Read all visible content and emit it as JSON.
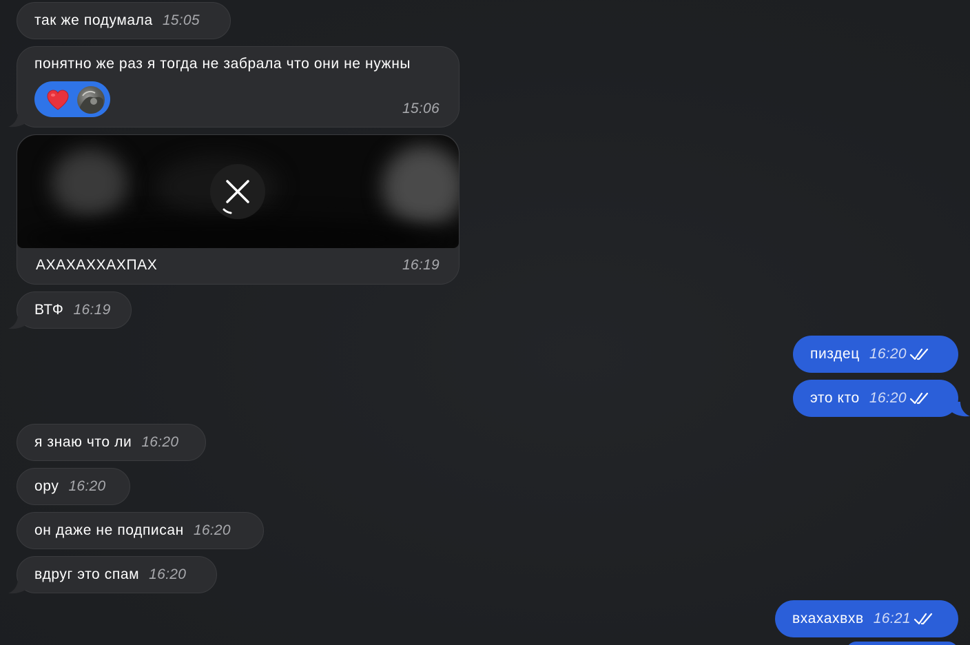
{
  "messages": [
    {
      "id": "m1",
      "text": "так же подумала",
      "time": "15:05"
    },
    {
      "id": "m2",
      "text": "понятно же раз я тогда не забрала что они не нужны",
      "time": "15:06"
    },
    {
      "id": "m3",
      "text": "АХАХАХХАХПАХ",
      "time": "16:19"
    },
    {
      "id": "m4",
      "text": "ВТФ",
      "time": "16:19"
    },
    {
      "id": "m5",
      "text": "пиздец",
      "time": "16:20"
    },
    {
      "id": "m6",
      "text": "это кто",
      "time": "16:20"
    },
    {
      "id": "m7",
      "text": "я знаю что ли",
      "time": "16:20"
    },
    {
      "id": "m8",
      "text": "ору",
      "time": "16:20"
    },
    {
      "id": "m9",
      "text": "он даже не подписан",
      "time": "16:20"
    },
    {
      "id": "m10",
      "text": "вдруг это спам",
      "time": "16:20"
    },
    {
      "id": "m11",
      "text": "вхахахвхв",
      "time": "16:21"
    }
  ],
  "reaction": {
    "emoji": "heart-icon"
  },
  "colors": {
    "background": "#1f2124",
    "incoming_bubble": "#2c2d30",
    "outgoing_bubble": "#2b5fd9",
    "reaction_pill": "#2f74e8",
    "heart": "#e8323c"
  }
}
